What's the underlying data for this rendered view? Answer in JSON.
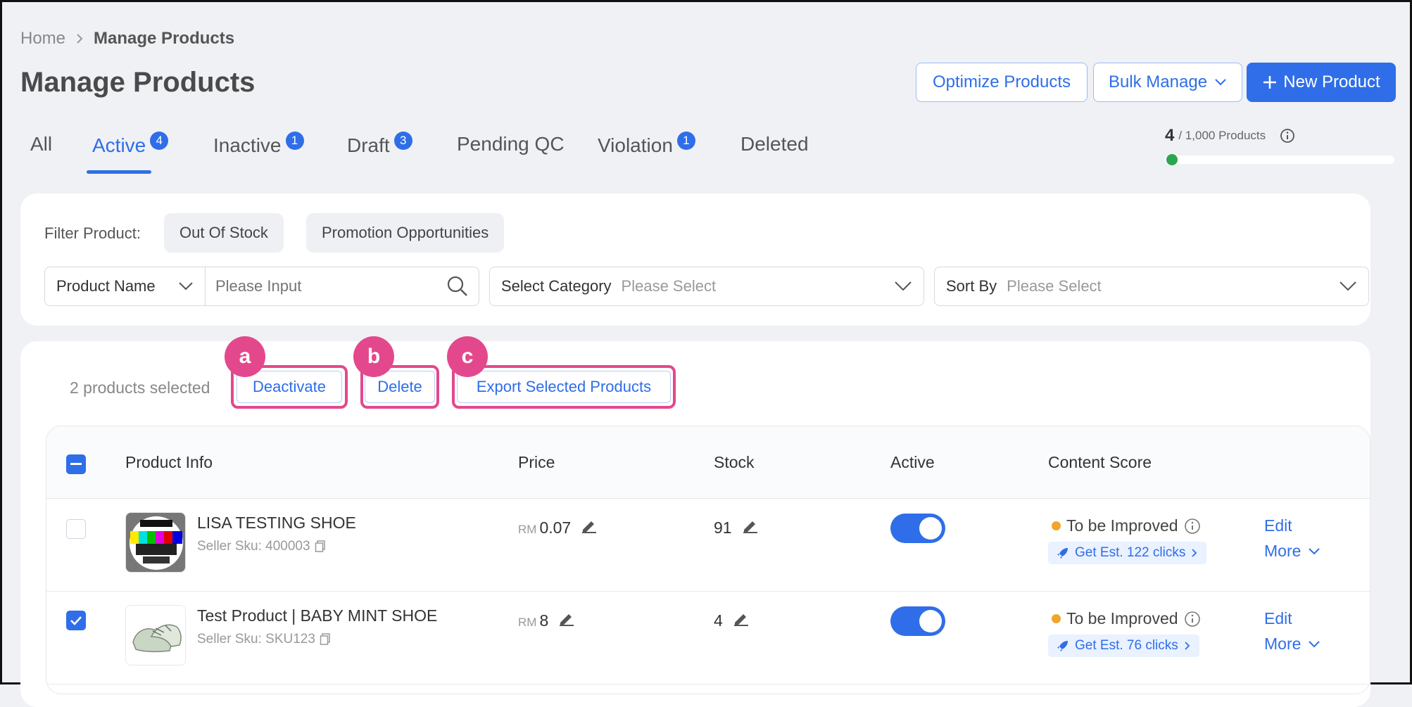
{
  "breadcrumb": {
    "home": "Home",
    "current": "Manage Products"
  },
  "page": {
    "title": "Manage Products"
  },
  "header_actions": {
    "optimize": "Optimize Products",
    "bulk": "Bulk Manage",
    "new_product": "New Product"
  },
  "tabs": [
    {
      "label": "All",
      "badge": null
    },
    {
      "label": "Active",
      "badge": "4"
    },
    {
      "label": "Inactive",
      "badge": "1"
    },
    {
      "label": "Draft",
      "badge": "3"
    },
    {
      "label": "Pending QC",
      "badge": null
    },
    {
      "label": "Violation",
      "badge": "1"
    },
    {
      "label": "Deleted",
      "badge": null
    }
  ],
  "quota": {
    "used": "4",
    "limit_text": "/ 1,000 Products",
    "fraction": 0.004
  },
  "filter": {
    "label": "Filter Product:",
    "chips": [
      "Out Of Stock",
      "Promotion Opportunities"
    ],
    "name_select": "Product Name",
    "search_placeholder": "Please Input",
    "category_label": "Select Category",
    "category_placeholder": "Please Select",
    "sort_label": "Sort By",
    "sort_placeholder": "Please Select"
  },
  "selection": {
    "count_text": "2 products selected",
    "actions": [
      "Deactivate",
      "Delete",
      "Export Selected Products"
    ],
    "markers": [
      "a",
      "b",
      "c"
    ]
  },
  "table": {
    "columns": [
      "Product Info",
      "Price",
      "Stock",
      "Active",
      "Content Score"
    ],
    "rows": [
      {
        "name": "LISA TESTING SHOE",
        "sku": "Seller Sku: 400003",
        "currency": "RM",
        "price": "0.07",
        "stock": "91",
        "active": true,
        "checked": false,
        "score": "To be Improved",
        "clicks": "Get Est. 122 clicks",
        "edit": "Edit",
        "more": "More"
      },
      {
        "name": "Test Product | BABY MINT SHOE",
        "sku": "Seller Sku: SKU123",
        "currency": "RM",
        "price": "8",
        "stock": "4",
        "active": true,
        "checked": true,
        "score": "To be Improved",
        "clicks": "Get Est. 76 clicks",
        "edit": "Edit",
        "more": "More"
      }
    ]
  },
  "colors": {
    "primary": "#2f6ee8",
    "highlight": "#e4488c",
    "warning": "#f0a52b",
    "success": "#2ea44f"
  }
}
